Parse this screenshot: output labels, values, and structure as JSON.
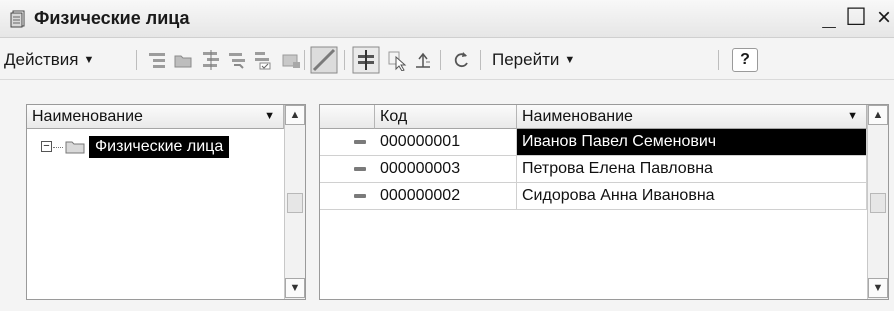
{
  "window": {
    "title": "Физические лица",
    "controls": {
      "minimize": "_",
      "maximize": "☐",
      "close": "×"
    }
  },
  "toolbar": {
    "actions_label": "Действия",
    "goto_label": "Перейти",
    "help_label": "?",
    "icons": [
      "hierarchy-icon",
      "folder-icon",
      "tree-expand-icon",
      "tree-level-icon",
      "edit-tree-icon",
      "disabled-icon",
      "list-mode-icon",
      "tree-mode-icon",
      "select-icon",
      "go-up-icon",
      "refresh-icon"
    ]
  },
  "tree": {
    "header": "Наименование",
    "items": [
      {
        "label": "Физические лица",
        "expanded": true,
        "selected": true
      }
    ]
  },
  "table": {
    "columns": [
      "",
      "Код",
      "Наименование"
    ],
    "rows": [
      {
        "code": "000000001",
        "name": "Иванов Павел Семенович",
        "selected": true
      },
      {
        "code": "000000003",
        "name": "Петрова Елена Павловна",
        "selected": false
      },
      {
        "code": "000000002",
        "name": "Сидорова Анна Ивановна",
        "selected": false
      }
    ]
  },
  "colors": {
    "selection": "#000000",
    "selection_text": "#ffffff",
    "background": "#f4f4f4"
  }
}
